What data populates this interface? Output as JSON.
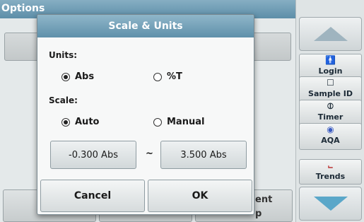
{
  "background": {
    "title": "Options",
    "bottom_buttons": [
      {
        "label_partial": "ent"
      },
      {
        "label_partial": "p"
      }
    ]
  },
  "sidebar": {
    "items": [
      {
        "name": "login",
        "label": "Login",
        "icon": "person-icon"
      },
      {
        "name": "sample-id",
        "label": "Sample ID",
        "icon": "sample-cup-icon"
      },
      {
        "name": "timer",
        "label": "Timer",
        "icon": "timer-icon"
      },
      {
        "name": "aqa",
        "label": "AQA",
        "icon": "aqa-icon"
      },
      {
        "name": "trends",
        "label": "Trends",
        "icon": "trend-chart-icon"
      }
    ]
  },
  "dialog": {
    "title": "Scale & Units",
    "units_label": "Units:",
    "units_options": [
      {
        "label": "Abs",
        "checked": true
      },
      {
        "label": "%T",
        "checked": false
      }
    ],
    "scale_label": "Scale:",
    "scale_options": [
      {
        "label": "Auto",
        "checked": true
      },
      {
        "label": "Manual",
        "checked": false
      }
    ],
    "range_min": "-0.300 Abs",
    "range_separator": "~",
    "range_max": "3.500 Abs",
    "cancel_label": "Cancel",
    "ok_label": "OK"
  },
  "colors": {
    "title_bar": "#6e9db6",
    "scroll_down_arrow": "#5aa7c9",
    "aqa_icon": "#3a5bc2",
    "login_icon": "#b3282d"
  }
}
